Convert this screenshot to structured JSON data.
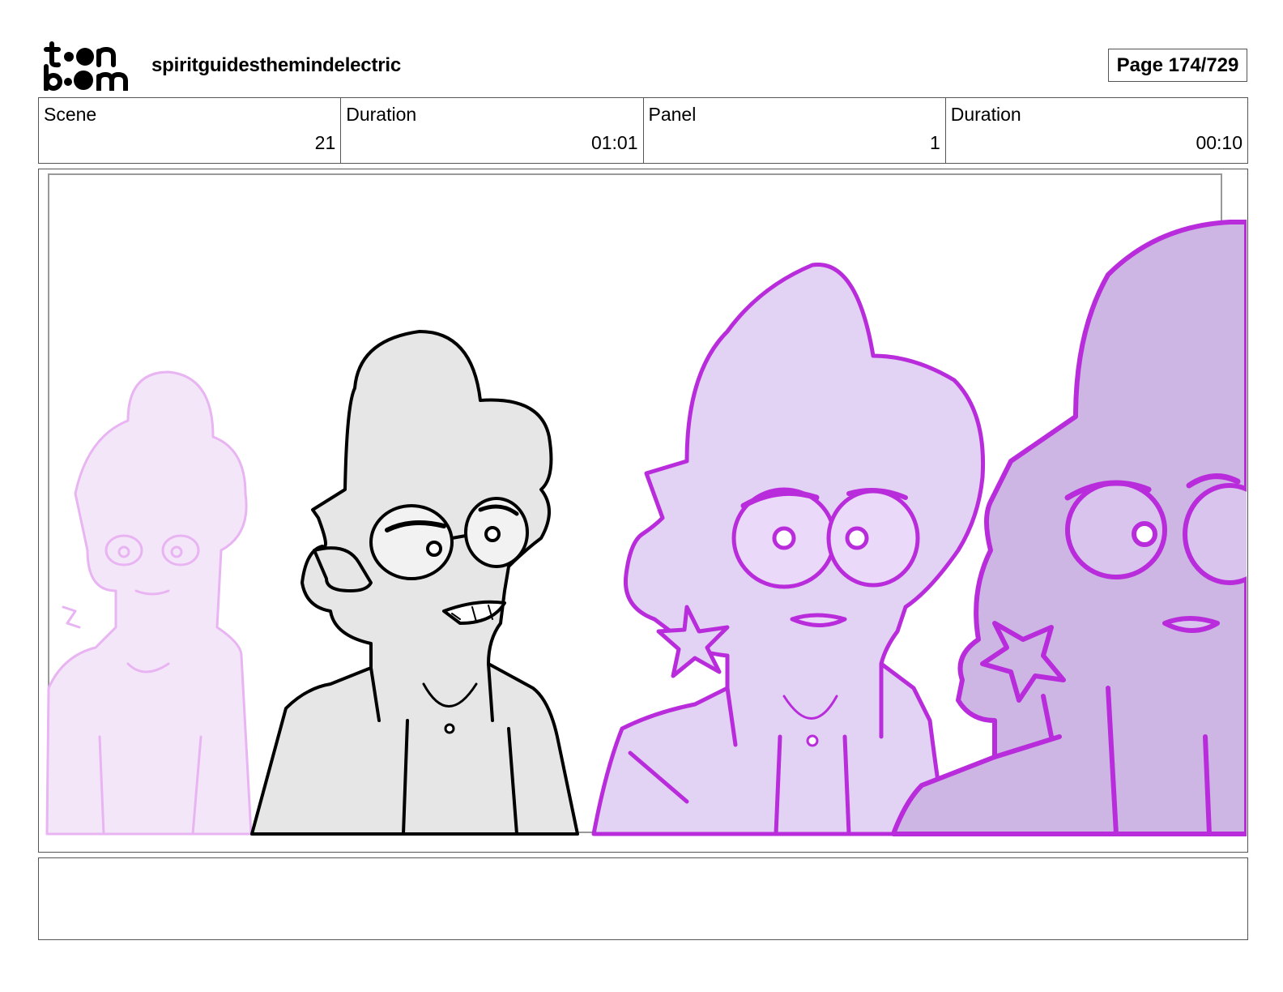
{
  "header": {
    "logo_text": "toonboom",
    "project_title": "spiritguidesthemindelectric",
    "page_label": "Page 174/729"
  },
  "info": {
    "scene_label": "Scene",
    "scene_value": "21",
    "scene_duration_label": "Duration",
    "scene_duration_value": "01:01",
    "panel_label": "Panel",
    "panel_value": "1",
    "panel_duration_label": "Duration",
    "panel_duration_value": "00:10"
  },
  "colors": {
    "ink": "#000000",
    "magenta": "#b92cdb",
    "lavender_fill": "#e2d2f4",
    "deep_lavender_fill": "#cdb6e3",
    "pale_pink": "#e8b4f2",
    "gray_fill": "#e6e6e6"
  },
  "notes": {
    "text": ""
  }
}
